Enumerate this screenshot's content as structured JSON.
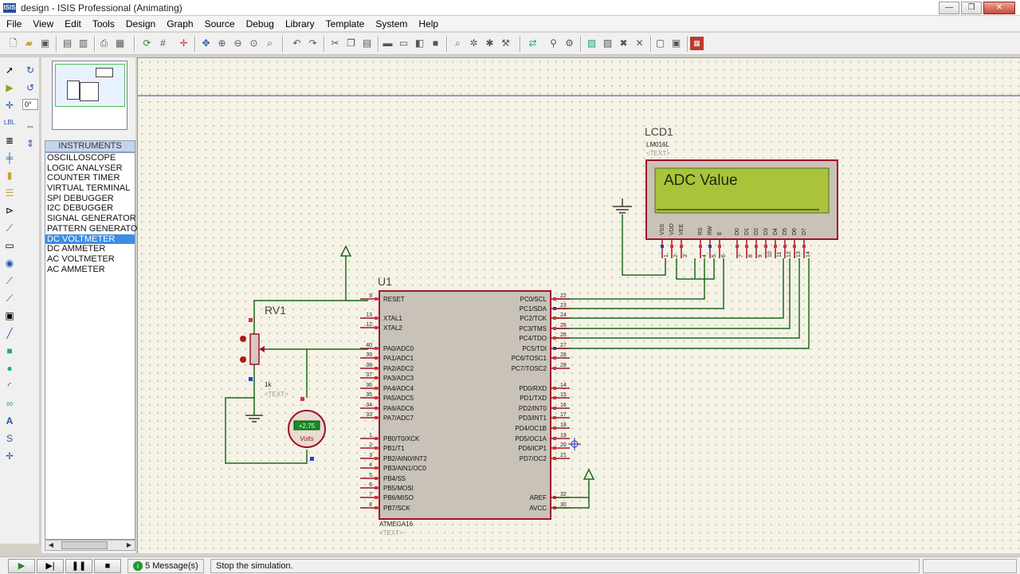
{
  "window": {
    "title": "design - ISIS Professional (Animating)",
    "app_icon": "ISIS",
    "min": "—",
    "max": "❐",
    "close": "✕"
  },
  "menu": [
    "File",
    "View",
    "Edit",
    "Tools",
    "Design",
    "Graph",
    "Source",
    "Debug",
    "Library",
    "Template",
    "System",
    "Help"
  ],
  "left_panel": {
    "rotation": "0°",
    "instruments_header": "INSTRUMENTS",
    "instruments": [
      "OSCILLOSCOPE",
      "LOGIC ANALYSER",
      "COUNTER TIMER",
      "VIRTUAL TERMINAL",
      "SPI DEBUGGER",
      "I2C DEBUGGER",
      "SIGNAL GENERATOR",
      "PATTERN GENERATOR",
      "DC VOLTMETER",
      "DC AMMETER",
      "AC VOLTMETER",
      "AC AMMETER"
    ],
    "selected_instrument": "DC VOLTMETER"
  },
  "schematic": {
    "lcd": {
      "ref": "LCD1",
      "part": "LM016L",
      "text": "<TEXT>",
      "display": "ADC Value",
      "pin_labels": [
        "VSS",
        "VDD",
        "VEE",
        "RS",
        "RW",
        "E",
        "D0",
        "D1",
        "D2",
        "D3",
        "D4",
        "D5",
        "D6",
        "D7"
      ],
      "pin_numbers": [
        "1",
        "2",
        "3",
        "4",
        "5",
        "6",
        "7",
        "8",
        "9",
        "10",
        "11",
        "12",
        "13",
        "14"
      ]
    },
    "mcu": {
      "ref": "U1",
      "part": "ATMEGA16",
      "text": "<TEXT>",
      "left_pins": [
        {
          "n": "9",
          "label": "RESET"
        },
        {
          "n": "13",
          "label": "XTAL1"
        },
        {
          "n": "12",
          "label": "XTAL2"
        },
        {
          "n": "40",
          "label": "PA0/ADC0"
        },
        {
          "n": "39",
          "label": "PA1/ADC1"
        },
        {
          "n": "38",
          "label": "PA2/ADC2"
        },
        {
          "n": "37",
          "label": "PA3/ADC3"
        },
        {
          "n": "36",
          "label": "PA4/ADC4"
        },
        {
          "n": "35",
          "label": "PA5/ADC5"
        },
        {
          "n": "34",
          "label": "PA6/ADC6"
        },
        {
          "n": "33",
          "label": "PA7/ADC7"
        },
        {
          "n": "1",
          "label": "PB0/T0/XCK"
        },
        {
          "n": "2",
          "label": "PB1/T1"
        },
        {
          "n": "3",
          "label": "PB2/AIN0/INT2"
        },
        {
          "n": "4",
          "label": "PB3/AIN1/OC0"
        },
        {
          "n": "5",
          "label": "PB4/SS"
        },
        {
          "n": "6",
          "label": "PB5/MOSI"
        },
        {
          "n": "7",
          "label": "PB6/MISO"
        },
        {
          "n": "8",
          "label": "PB7/SCK"
        }
      ],
      "right_pins": [
        {
          "n": "22",
          "label": "PC0/SCL"
        },
        {
          "n": "23",
          "label": "PC1/SDA"
        },
        {
          "n": "24",
          "label": "PC2/TCK"
        },
        {
          "n": "25",
          "label": "PC3/TMS"
        },
        {
          "n": "26",
          "label": "PC4/TDO"
        },
        {
          "n": "27",
          "label": "PC5/TDI"
        },
        {
          "n": "28",
          "label": "PC6/TOSC1"
        },
        {
          "n": "29",
          "label": "PC7/TOSC2"
        },
        {
          "n": "14",
          "label": "PD0/RXD"
        },
        {
          "n": "15",
          "label": "PD1/TXD"
        },
        {
          "n": "16",
          "label": "PD2/INT0"
        },
        {
          "n": "17",
          "label": "PD3/INT1"
        },
        {
          "n": "18",
          "label": "PD4/OC1B"
        },
        {
          "n": "19",
          "label": "PD5/OC1A"
        },
        {
          "n": "20",
          "label": "PD6/ICP1"
        },
        {
          "n": "21",
          "label": "PD7/OC2"
        },
        {
          "n": "32",
          "label": "AREF"
        },
        {
          "n": "30",
          "label": "AVCC"
        }
      ]
    },
    "pot": {
      "ref": "RV1",
      "value": "1k",
      "text": "<TEXT>",
      "wiper_pct": "50"
    },
    "voltmeter": {
      "reading": "+2.75",
      "unit": "Volts"
    }
  },
  "status": {
    "messages": "5 Message(s)",
    "text": "Stop the simulation."
  }
}
